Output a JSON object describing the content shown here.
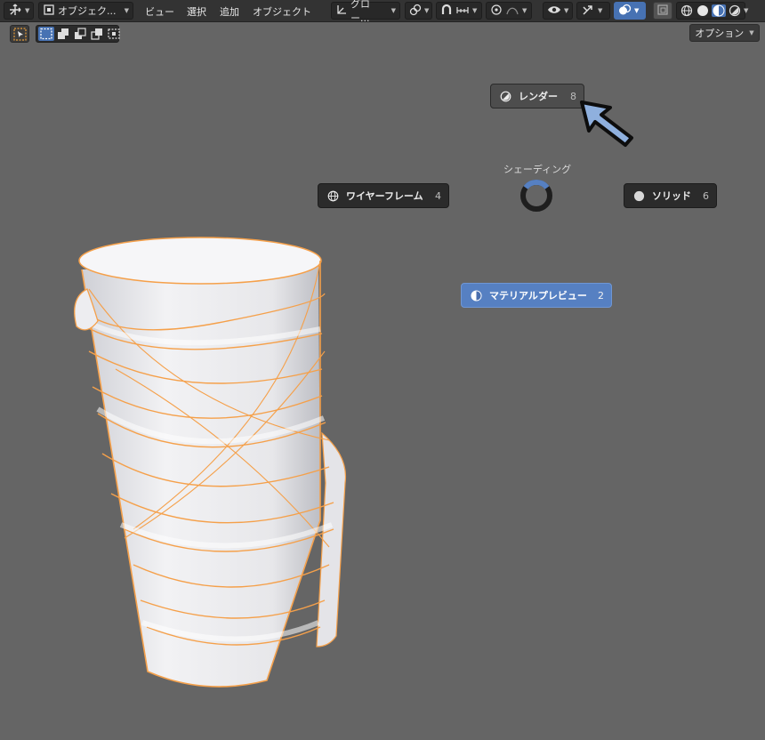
{
  "header": {
    "mode_label": "オブジェク...",
    "menus": [
      "ビュー",
      "選択",
      "追加",
      "オブジェクト"
    ],
    "transform_orientation": "グロー..."
  },
  "toolbar": {
    "options_label": "オプション"
  },
  "pie_menu": {
    "title": "シェーディング",
    "render": {
      "label": "レンダー",
      "shortcut": "8"
    },
    "wireframe": {
      "label": "ワイヤーフレーム",
      "shortcut": "4"
    },
    "solid": {
      "label": "ソリッド",
      "shortcut": "6"
    },
    "material_preview": {
      "label": "マテリアルプレビュー",
      "shortcut": "2"
    }
  },
  "colors": {
    "viewport_bg": "#656565",
    "header_bg": "#333333",
    "accent": "#5680c2",
    "selection_outline": "#f5a04a",
    "arrow_fill": "#8fb0de"
  },
  "icons": {
    "editor_type": "transform-gizmo-icon",
    "mode": "object-mode-icon",
    "orientation": "axes-icon",
    "pivot": "link-icon",
    "snap": "magnet-icon",
    "snap_target": "increment-icon",
    "proportional": "proportional-edit-icon",
    "falloff": "falloff-curve-icon",
    "visibility": "eye-icon",
    "gizmo": "gizmo-icon",
    "overlay": "overlay-icon",
    "xray": "xray-icon",
    "shading_wire": "wireframe-shading-icon",
    "shading_solid": "solid-shading-icon",
    "shading_material": "material-shading-icon",
    "shading_render": "rendered-shading-icon",
    "select_tool": "select-cursor-icon",
    "select_modes": [
      "select-new-icon",
      "select-extend-icon",
      "select-subtract-icon",
      "select-invert-icon",
      "select-intersect-icon"
    ]
  }
}
